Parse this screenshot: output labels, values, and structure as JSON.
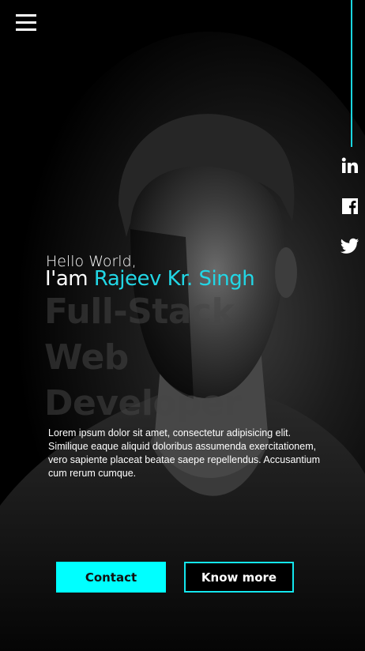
{
  "hero": {
    "greeting": "Hello World,",
    "intro_prefix": "I'am",
    "name": "Rajeev Kr. Singh",
    "role": "Full-Stack Web Developer",
    "description": "Lorem ipsum dolor sit amet, consectetur adipisicing elit. Similique eaque aliquid doloribus assumenda exercitationem, vero sapiente placeat beatae saepe repellendus. Accusantium cum rerum cumque."
  },
  "buttons": {
    "contact": "Contact",
    "know_more": "Know more"
  },
  "social": [
    "linkedin-icon",
    "facebook-icon",
    "twitter-icon"
  ],
  "menu_icon": "hamburger-menu-icon",
  "colors": {
    "accent": "#22d7e6",
    "contact_button": "#00ffff",
    "background": "#000000"
  }
}
